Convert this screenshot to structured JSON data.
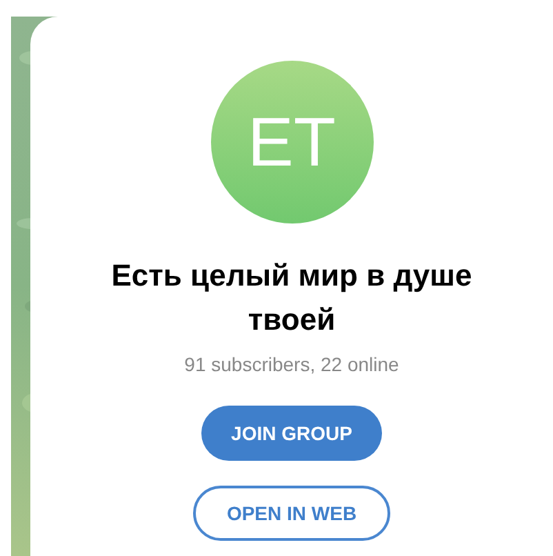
{
  "avatar": {
    "initials": "ET"
  },
  "title": "Есть целый мир в душе твоей",
  "subtitle": "91 subscribers, 22 online",
  "buttons": [
    {
      "label": "JOIN GROUP",
      "kind": "primary"
    },
    {
      "label": "OPEN IN WEB",
      "kind": "outline"
    }
  ]
}
